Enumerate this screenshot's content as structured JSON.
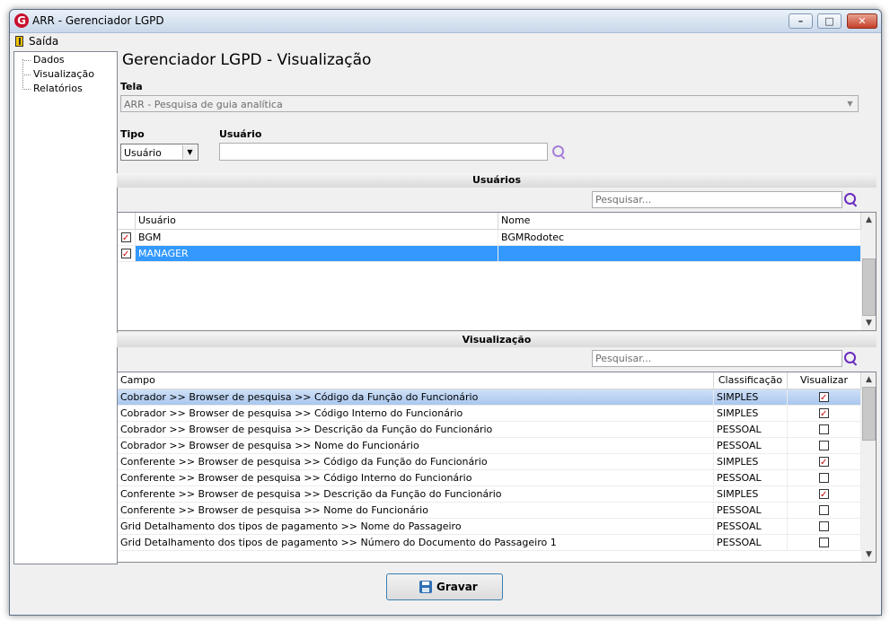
{
  "window": {
    "title": "ARR - Gerenciador LGPD"
  },
  "menu": {
    "exit_label": "Saída"
  },
  "tree": {
    "items": [
      "Dados",
      "Visualização",
      "Relatórios"
    ]
  },
  "page": {
    "heading": "Gerenciador LGPD - Visualização"
  },
  "form": {
    "tela_label": "Tela",
    "tela_value": "ARR - Pesquisa de guia analítica",
    "tipo_label": "Tipo",
    "tipo_value": "Usuário",
    "usuario_label": "Usuário",
    "usuario_value": ""
  },
  "users_section": {
    "title": "Usuários",
    "search_placeholder": "Pesquisar...",
    "columns": [
      "Usuário",
      "Nome"
    ],
    "rows": [
      {
        "checked": true,
        "usuario": "BGM",
        "nome": "BGMRodotec"
      },
      {
        "checked": true,
        "usuario": "MANAGER",
        "nome": ""
      }
    ]
  },
  "view_section": {
    "title": "Visualização",
    "search_placeholder": "Pesquisar...",
    "columns": [
      "Campo",
      "Classificação",
      "Visualizar"
    ],
    "rows": [
      {
        "campo": "Cobrador >> Browser de pesquisa >> Código da Função do Funcionário",
        "classificacao": "SIMPLES",
        "visualizar": true
      },
      {
        "campo": "Cobrador >> Browser de pesquisa >> Código Interno do Funcionário",
        "classificacao": "SIMPLES",
        "visualizar": true
      },
      {
        "campo": "Cobrador >> Browser de pesquisa >> Descrição da Função do Funcionário",
        "classificacao": "PESSOAL",
        "visualizar": false
      },
      {
        "campo": "Cobrador >> Browser de pesquisa >> Nome do Funcionário",
        "classificacao": "PESSOAL",
        "visualizar": false
      },
      {
        "campo": "Conferente >> Browser de pesquisa >> Código da Função do Funcionário",
        "classificacao": "SIMPLES",
        "visualizar": true
      },
      {
        "campo": "Conferente >> Browser de pesquisa >> Código Interno do Funcionário",
        "classificacao": "PESSOAL",
        "visualizar": false
      },
      {
        "campo": "Conferente >> Browser de pesquisa >> Descrição da Função do Funcionário",
        "classificacao": "SIMPLES",
        "visualizar": true
      },
      {
        "campo": "Conferente >> Browser de pesquisa >> Nome do Funcionário",
        "classificacao": "PESSOAL",
        "visualizar": false
      },
      {
        "campo": "Grid Detalhamento dos tipos de pagamento >> Nome do Passageiro",
        "classificacao": "PESSOAL",
        "visualizar": false
      },
      {
        "campo": "Grid Detalhamento dos tipos de pagamento >> Número do Documento do Passageiro 1",
        "classificacao": "PESSOAL",
        "visualizar": false
      }
    ]
  },
  "actions": {
    "save_label": "Gravar"
  },
  "colors": {
    "selection": "#3399ff",
    "accent": "#6a2bbf",
    "check": "#d00000"
  }
}
